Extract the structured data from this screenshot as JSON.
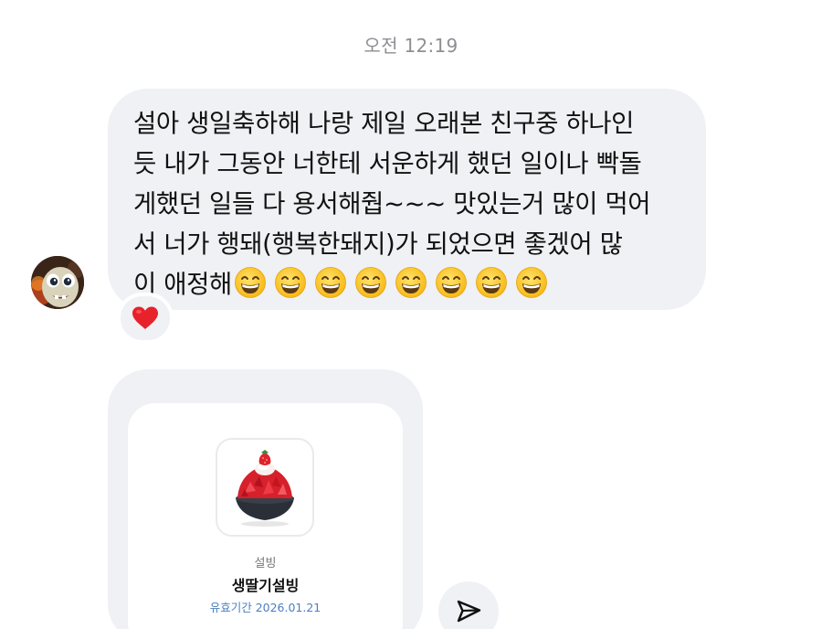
{
  "chat": {
    "timestamp": "오전 12:19",
    "message": {
      "lines": [
        "설아 생일축하해 나랑 제일 오래본 친구중 하나인",
        "듯 내가 그동안 너한테 서운하게 했던 일이나 빡돌",
        "게했던 일들 다 용서해줩~~~ 맛있는거 많이 먹어",
        "서 너가 행돼(행복한돼지)가 되었으면 좋겠어 많",
        "이 애정해"
      ],
      "emoji_icon": "grinning-face-with-smiling-eyes-icon",
      "emoji_count": 8
    },
    "reaction_icon": "red-heart-icon",
    "gift": {
      "brand": "설빙",
      "product_name": "생딸기설빙",
      "validity": "유효기간 2026.01.21",
      "image_icon": "strawberry-bingsu-icon"
    },
    "share_icon": "paper-plane-send-icon"
  },
  "colors": {
    "bubble_bg": "#eff1f4",
    "timestamp": "#8e8e93",
    "validity": "#4a7fc1",
    "heart": "#e8222b"
  }
}
